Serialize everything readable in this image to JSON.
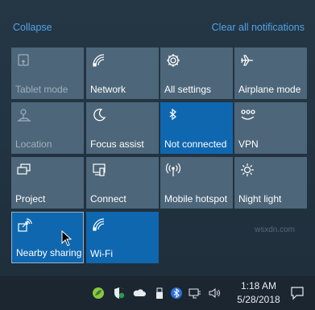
{
  "header": {
    "collapse_label": "Collapse",
    "clear_all_label": "Clear all notifications"
  },
  "tiles": [
    {
      "label": "Tablet mode",
      "icon": "tablet-mode-icon",
      "state": "disabled"
    },
    {
      "label": "Network",
      "icon": "network-icon",
      "state": "normal"
    },
    {
      "label": "All settings",
      "icon": "settings-gear-icon",
      "state": "normal"
    },
    {
      "label": "Airplane mode",
      "icon": "airplane-icon",
      "state": "normal"
    },
    {
      "label": "Location",
      "icon": "location-icon",
      "state": "disabled"
    },
    {
      "label": "Focus assist",
      "icon": "moon-icon",
      "state": "normal"
    },
    {
      "label": "Not connected",
      "icon": "bluetooth-icon",
      "state": "active"
    },
    {
      "label": "VPN",
      "icon": "vpn-icon",
      "state": "normal"
    },
    {
      "label": "Project",
      "icon": "project-icon",
      "state": "normal"
    },
    {
      "label": "Connect",
      "icon": "connect-icon",
      "state": "normal"
    },
    {
      "label": "Mobile hotspot",
      "icon": "hotspot-icon",
      "state": "normal"
    },
    {
      "label": "Night light",
      "icon": "night-light-icon",
      "state": "normal"
    },
    {
      "label": "Nearby sharing",
      "icon": "nearby-sharing-icon",
      "state": "active"
    },
    {
      "label": "Wi-Fi",
      "icon": "wifi-icon",
      "state": "active"
    }
  ],
  "taskbar": {
    "time": "1:18 AM",
    "date": "5/28/2018",
    "tray_icons": [
      "leaf-icon",
      "shield-icon",
      "onedrive-cloud-icon",
      "usb-drive-icon",
      "bluetooth-icon",
      "power-icon",
      "network-icon",
      "volume-icon"
    ]
  },
  "colors": {
    "panel_bg": "#22303c",
    "tile_bg": "#4d6679",
    "tile_active_bg": "#0f67b0",
    "link_color": "#4fa3e8",
    "taskbar_bg": "#1b2630"
  },
  "watermark": "wsxdn.com"
}
